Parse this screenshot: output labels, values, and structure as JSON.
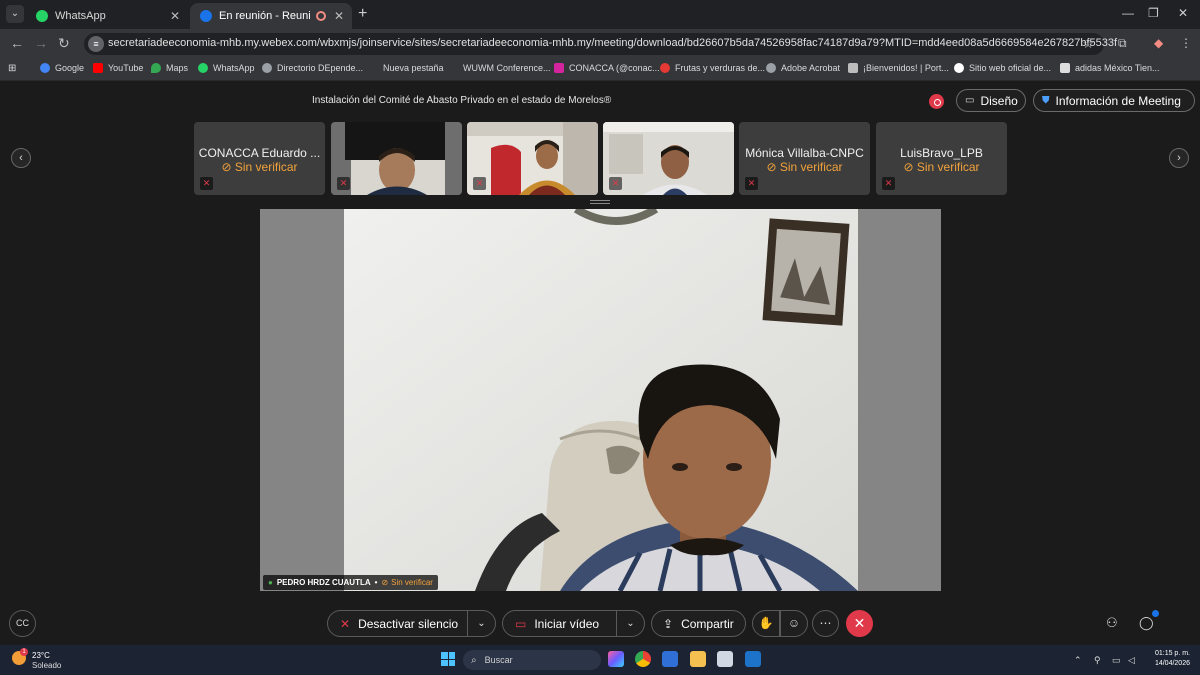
{
  "browser": {
    "tabs": [
      {
        "title": "WhatsApp",
        "active": false,
        "favicon": "whatsapp-icon",
        "color": "#25d366"
      },
      {
        "title": "En reunión - Reunión - Web",
        "active": true,
        "favicon": "webex-icon",
        "color": "#1a73e8"
      }
    ],
    "url": "secretariadeeconomia-mhb.my.webex.com/wbxmjs/joinservice/sites/secretariadeeconomia-mhb.my/meeting/download/bd26607b5da74526958fac74187d9a79?MTID=mdd4eed08a5d6669584e267827bf5533f",
    "bookmarks": [
      {
        "label": "Google",
        "icon": "google-icon",
        "color": "#4285f4"
      },
      {
        "label": "YouTube",
        "icon": "youtube-icon",
        "color": "#ff0000"
      },
      {
        "label": "Maps",
        "icon": "maps-icon",
        "color": "#34a853"
      },
      {
        "label": "WhatsApp",
        "icon": "whatsapp-icon",
        "color": "#25d366"
      },
      {
        "label": "Directorio DEpende...",
        "icon": "globe-icon",
        "color": "#9aa0a6"
      },
      {
        "label": "Nueva pestaña",
        "icon": "blank-icon",
        "color": "#35363a"
      },
      {
        "label": "WUWM Conference...",
        "icon": "blank-icon",
        "color": "#35363a"
      },
      {
        "label": "CONACCA (@conac...",
        "icon": "instagram-icon",
        "color": "#d6249f"
      },
      {
        "label": "Frutas y verduras de...",
        "icon": "fruit-icon",
        "color": "#e53935"
      },
      {
        "label": "Adobe Acrobat",
        "icon": "globe-icon",
        "color": "#9aa0a6"
      },
      {
        "label": "¡Bienvenidos! | Port...",
        "icon": "portal-icon",
        "color": "#bdbdbd"
      },
      {
        "label": "Sitio web oficial de...",
        "icon": "site-icon",
        "color": "#ffffff"
      },
      {
        "label": "adidas México Tien...",
        "icon": "adidas-icon",
        "color": "#dddddd"
      }
    ]
  },
  "meeting": {
    "title": "Instalación del Comité de Abasto Privado en el estado de Morelos®",
    "layout_label": "Diseño",
    "info_label": "Información de Meeting",
    "accent": "#e0394a",
    "status_color": "#f2a23a"
  },
  "participants": [
    {
      "name": "CONACCA Eduardo ...",
      "status": "Sin verificar",
      "video": false
    },
    {
      "name": "",
      "status": "",
      "video": true
    },
    {
      "name": "",
      "status": "",
      "video": true
    },
    {
      "name": "",
      "status": "",
      "video": true
    },
    {
      "name": "Mónica Villalba-CNPC",
      "status": "Sin verificar",
      "video": false
    },
    {
      "name": "LuisBravo_LPB",
      "status": "Sin verificar",
      "video": false
    }
  ],
  "active_speaker": {
    "name": "PEDRO HRDZ CUAUTLA",
    "separator": "•",
    "status": "Sin verificar"
  },
  "controls": {
    "mute_label": "Desactivar silencio",
    "video_label": "Iniciar vídeo",
    "share_label": "Compartir"
  },
  "taskbar": {
    "temperature": "23°C",
    "condition": "Soleado",
    "search_placeholder": "Buscar",
    "time": "01:15 p. m.",
    "date": "14/04/2026",
    "weather_badge": "1"
  }
}
